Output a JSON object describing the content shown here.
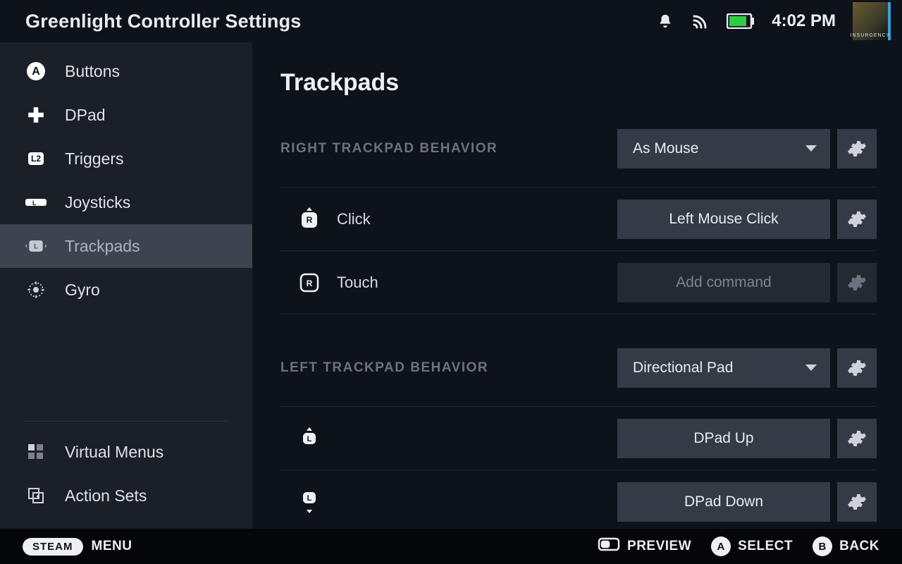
{
  "header": {
    "title": "Greenlight Controller Settings",
    "clock": "4:02 PM",
    "avatar_tag": "INSURGENCY"
  },
  "sidebar": {
    "items": [
      {
        "label": "Buttons",
        "icon": "a-button-icon"
      },
      {
        "label": "DPad",
        "icon": "dpad-icon"
      },
      {
        "label": "Triggers",
        "icon": "l2-icon"
      },
      {
        "label": "Joysticks",
        "icon": "joystick-icon"
      },
      {
        "label": "Trackpads",
        "icon": "trackpad-icon",
        "selected": true
      },
      {
        "label": "Gyro",
        "icon": "gyro-icon"
      }
    ],
    "secondary": [
      {
        "label": "Virtual Menus",
        "icon": "grid-icon"
      },
      {
        "label": "Action Sets",
        "icon": "layers-icon"
      }
    ]
  },
  "main": {
    "heading": "Trackpads",
    "sections": [
      {
        "title": "RIGHT TRACKPAD BEHAVIOR",
        "behavior_value": "As Mouse",
        "rows": [
          {
            "glyph": "R",
            "glyph_style": "click",
            "label": "Click",
            "value": "Left Mouse Click",
            "placeholder": false
          },
          {
            "glyph": "R",
            "glyph_style": "touch",
            "label": "Touch",
            "value": "Add command",
            "placeholder": true
          }
        ]
      },
      {
        "title": "LEFT TRACKPAD BEHAVIOR",
        "behavior_value": "Directional Pad",
        "rows": [
          {
            "glyph": "L",
            "glyph_style": "up",
            "label": "",
            "value": "DPad Up",
            "placeholder": false
          },
          {
            "glyph": "L",
            "glyph_style": "down",
            "label": "",
            "value": "DPad Down",
            "placeholder": false
          }
        ]
      }
    ]
  },
  "footer": {
    "steam": "STEAM",
    "menu": "MENU",
    "hints": [
      {
        "icon": "preview-icon",
        "label": "PREVIEW"
      },
      {
        "icon": "a-button",
        "label": "SELECT"
      },
      {
        "icon": "b-button",
        "label": "BACK"
      }
    ]
  }
}
